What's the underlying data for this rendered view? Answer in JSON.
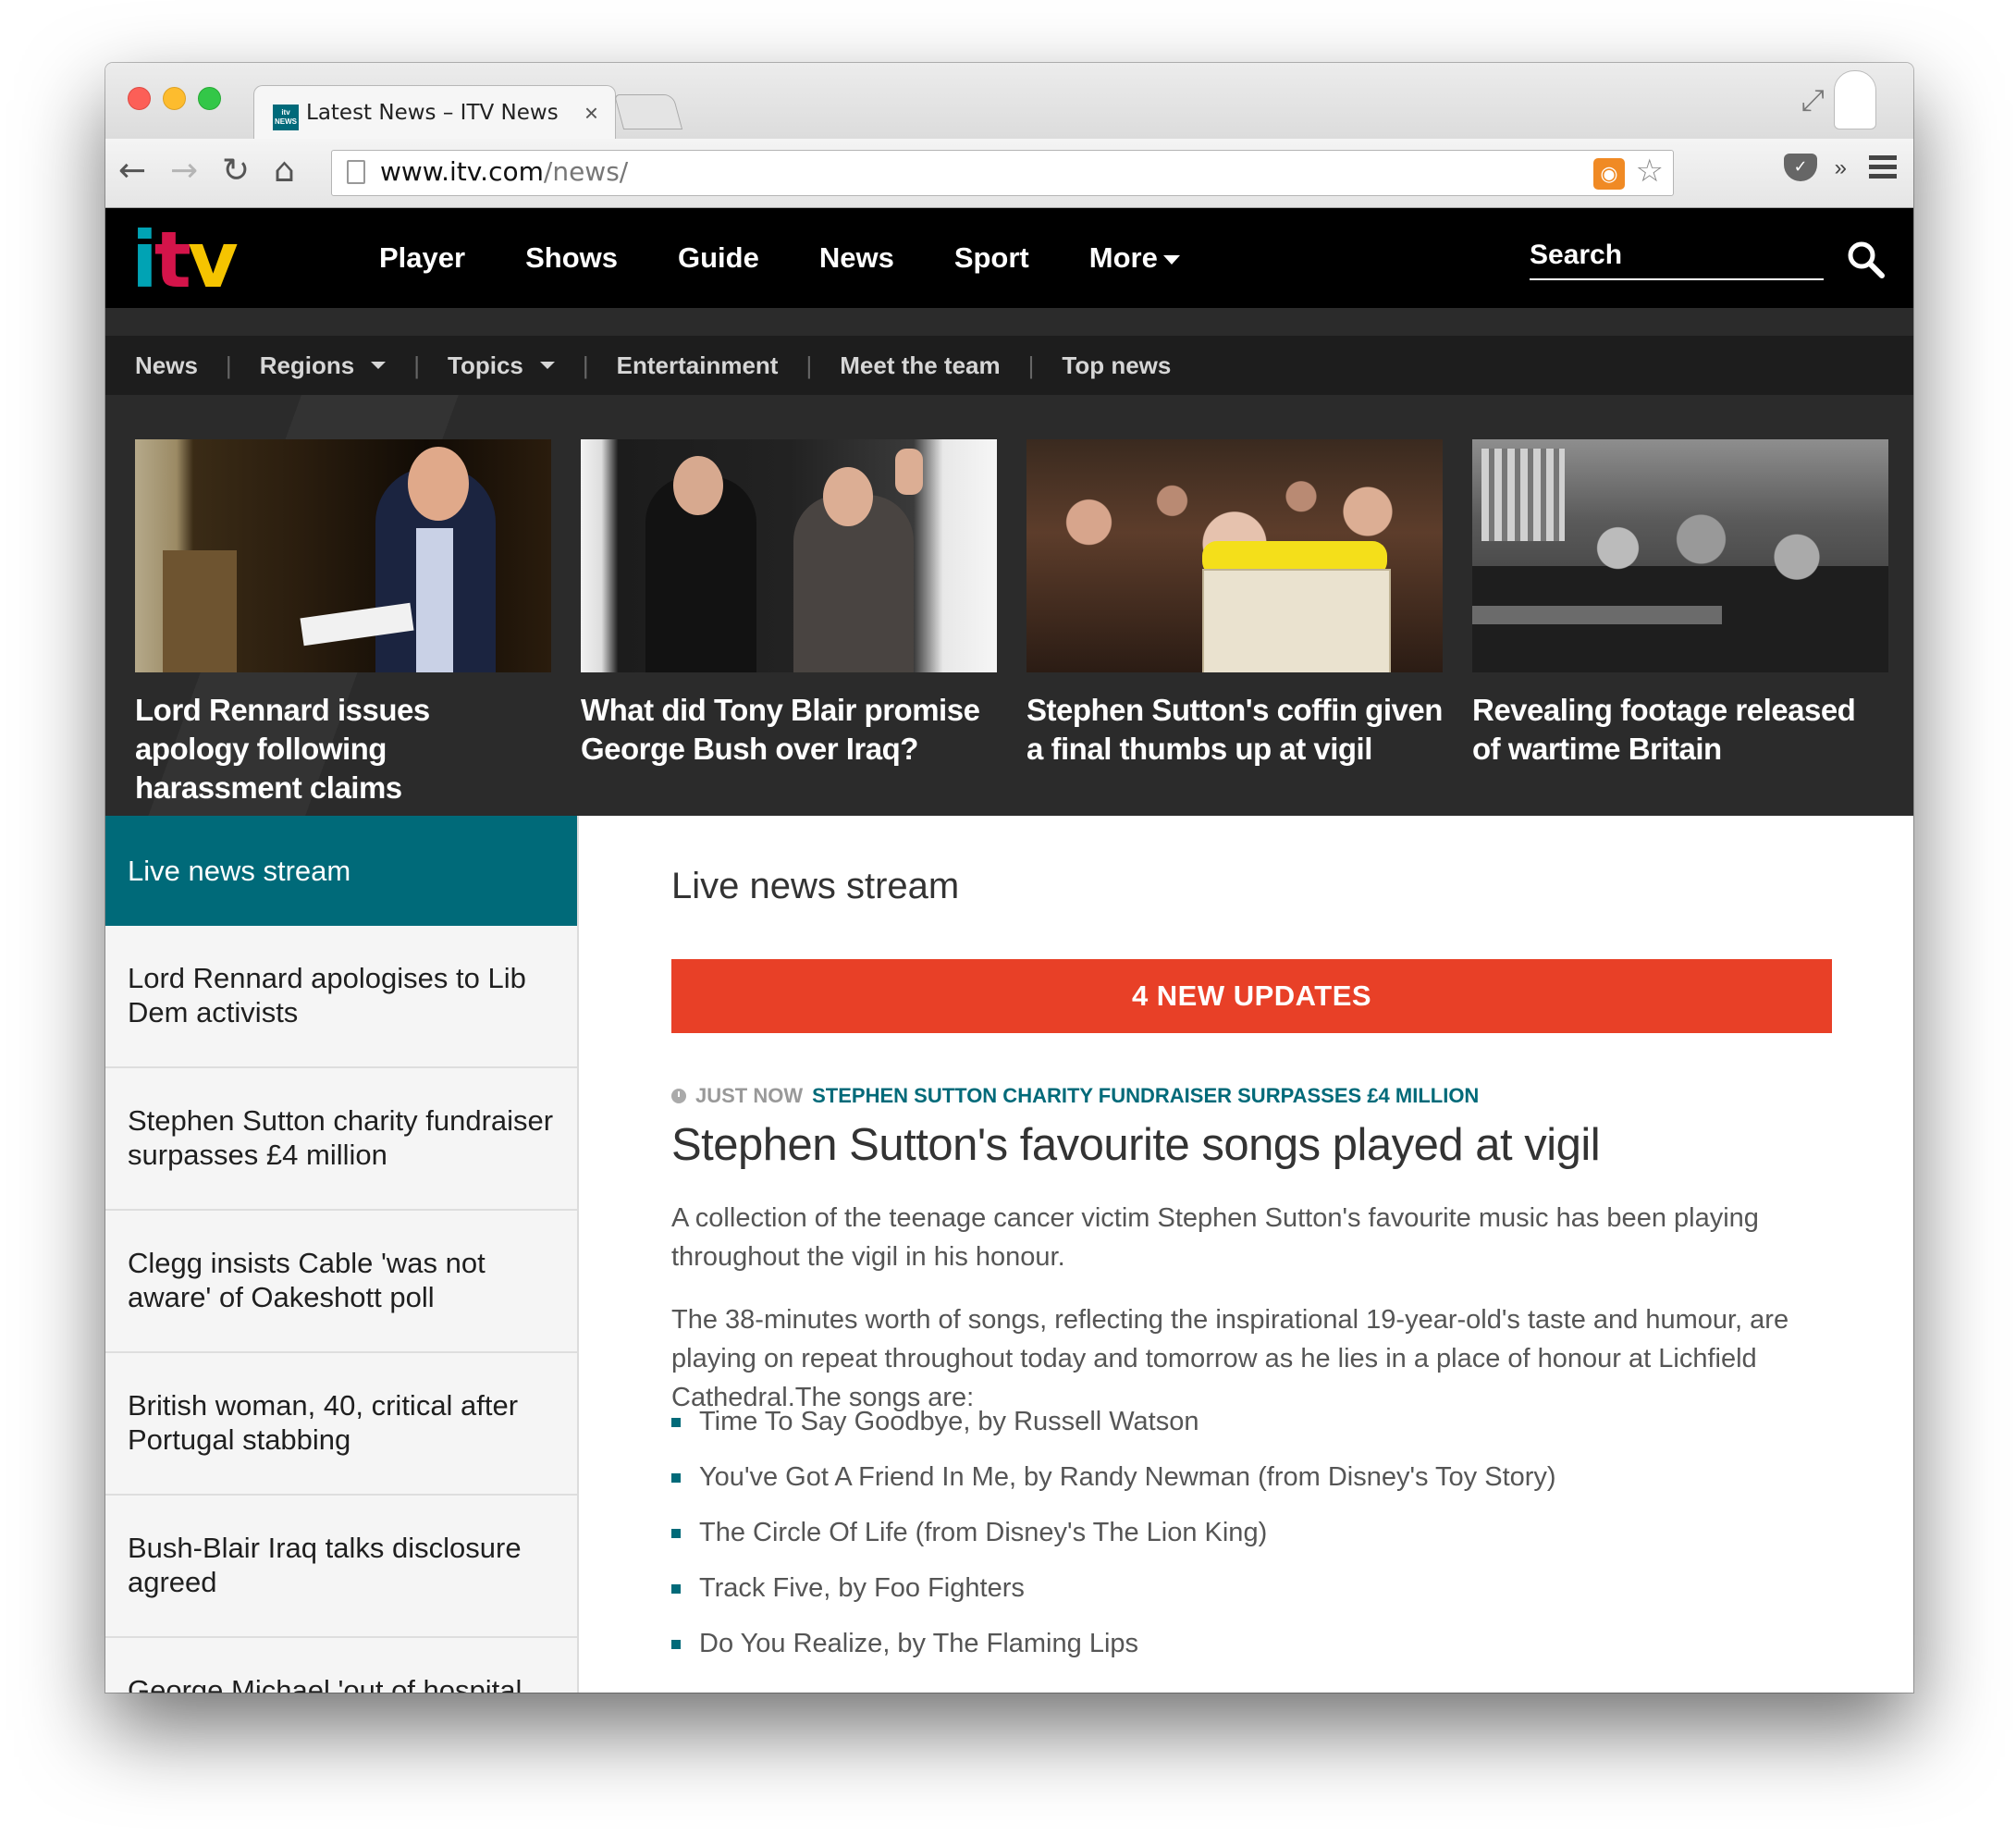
{
  "browser": {
    "tab_title": "Latest News – ITV News",
    "tab_favicon_text": "itv NEWS",
    "url_host": "www.itv.com",
    "url_path": "/news/"
  },
  "site": {
    "logo_text": "itv",
    "brand_colors": {
      "teal": "#006a79",
      "red": "#e84027",
      "logo_teal": "#00a3b4",
      "logo_pink": "#d4144a",
      "logo_yellow": "#f5c400"
    },
    "main_nav": [
      "Player",
      "Shows",
      "Guide",
      "News",
      "Sport",
      "More"
    ],
    "search_placeholder": "Search",
    "sub_nav": [
      "News",
      "Regions",
      "Topics",
      "Entertainment",
      "Meet the team",
      "Top news"
    ],
    "featured": [
      {
        "title": "Lord Rennard issues apology following harassment claims"
      },
      {
        "title": "What did Tony Blair promise George Bush over Iraq?"
      },
      {
        "title": "Stephen Sutton's coffin given a final thumbs up at vigil"
      },
      {
        "title": "Revealing footage released of wartime Britain"
      }
    ],
    "sidebar": {
      "header": "Live news stream",
      "items": [
        "Lord Rennard apologises to Lib Dem activists",
        "Stephen Sutton charity fundraiser surpasses £4 million",
        "Clegg insists Cable 'was not aware' of Oakeshott poll",
        "British woman, 40, critical after Portugal stabbing",
        "Bush-Blair Iraq talks disclosure agreed",
        "George Michael 'out of hospital"
      ]
    },
    "main": {
      "heading": "Live news stream",
      "updates_button": "4 NEW UPDATES",
      "time_label": "JUST NOW",
      "tag": "STEPHEN SUTTON CHARITY FUNDRAISER SURPASSES £4 MILLION",
      "headline": "Stephen Sutton's favourite songs played at vigil",
      "para1": "A collection of the teenage cancer victim Stephen Sutton's favourite music has been playing throughout the vigil in his honour.",
      "para2": "The 38-minutes worth of songs, reflecting the inspirational 19-year-old's taste and humour, are playing on repeat throughout today and tomorrow as he lies in a place of honour at Lichfield Cathedral.The songs are:",
      "songs": [
        " Time To Say Goodbye, by Russell Watson",
        "You've Got A Friend In Me, by Randy Newman (from Disney's Toy Story)",
        "The Circle Of Life (from Disney's The Lion King)",
        "Track Five, by Foo Fighters",
        "Do You Realize, by The Flaming Lips"
      ]
    }
  }
}
